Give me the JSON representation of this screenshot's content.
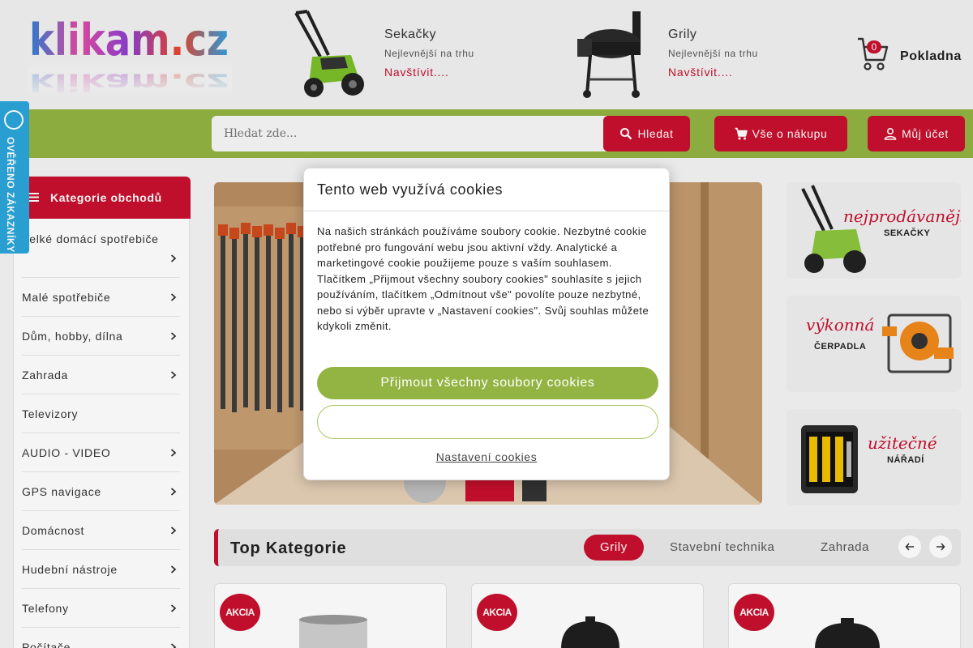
{
  "logo": {
    "text": "klikam.cz"
  },
  "promos": [
    {
      "title": "Sekačky",
      "subtitle": "Nejlevnější na trhu",
      "link": "Navštívit...."
    },
    {
      "title": "Grily",
      "subtitle": "Nejlevnější na trhu",
      "link": "Navštívit...."
    }
  ],
  "cart": {
    "count": "0",
    "checkout_label": "Pokladna"
  },
  "search": {
    "placeholder": "Hledat zde...",
    "button_label": "Hledat"
  },
  "nav_buttons": {
    "about_label": "Vše o nákupu",
    "account_label": "Můj účet"
  },
  "verified_badge": {
    "text": "OVĚŘENO ZÁKAZNÍKY"
  },
  "sidebar": {
    "header": "Kategorie obchodů",
    "items": [
      {
        "label": "Velké domácí spotřebiče"
      },
      {
        "label": "Malé spotřebiče"
      },
      {
        "label": "Dům, hobby, dílna"
      },
      {
        "label": "Zahrada"
      },
      {
        "label": "Televizory"
      },
      {
        "label": "AUDIO - VIDEO"
      },
      {
        "label": "GPS navigace"
      },
      {
        "label": "Domácnost"
      },
      {
        "label": "Hudební nástroje"
      },
      {
        "label": "Telefony"
      },
      {
        "label": "Počítače"
      }
    ]
  },
  "banners": [
    {
      "title": "nejprodávanější",
      "subtitle": "SEKAČKY"
    },
    {
      "title": "výkonná",
      "subtitle": "ČERPADLA"
    },
    {
      "title": "užitečné",
      "subtitle": "NÁŘADÍ"
    }
  ],
  "top_categories": {
    "title": "Top Kategorie",
    "tabs": [
      {
        "label": "Grily",
        "active": true
      },
      {
        "label": "Stavební technika",
        "active": false
      },
      {
        "label": "Zahrada",
        "active": false
      }
    ]
  },
  "products": [
    {
      "badge": "AKCIA"
    },
    {
      "badge": "AKCIA"
    },
    {
      "badge": "AKCIA"
    }
  ],
  "cookie_modal": {
    "title": "Tento web využívá cookies",
    "text": "Na našich stránkách používáme soubory cookie. Nezbytné cookie potřebné pro fungování webu jsou aktivní vždy. Analytické a marketingové cookie použijeme pouze s vaším souhlasem. Tlačítkem „Přijmout všechny soubory cookies\" souhlasíte s jejich používáním, tlačítkem „Odmítnout vše\" povolíte pouze nezbytné, nebo si výběr upravte v „Nastavení cookies\". Svůj souhlas můžete kdykoli změnit.",
    "accept_label": "Přijmout všechny soubory cookies",
    "reject_label": "",
    "settings_label": "Nastavení cookies"
  },
  "colors": {
    "accent_red": "#c8102e",
    "accent_green": "#93b443",
    "badge_blue": "#2aa6d9"
  }
}
